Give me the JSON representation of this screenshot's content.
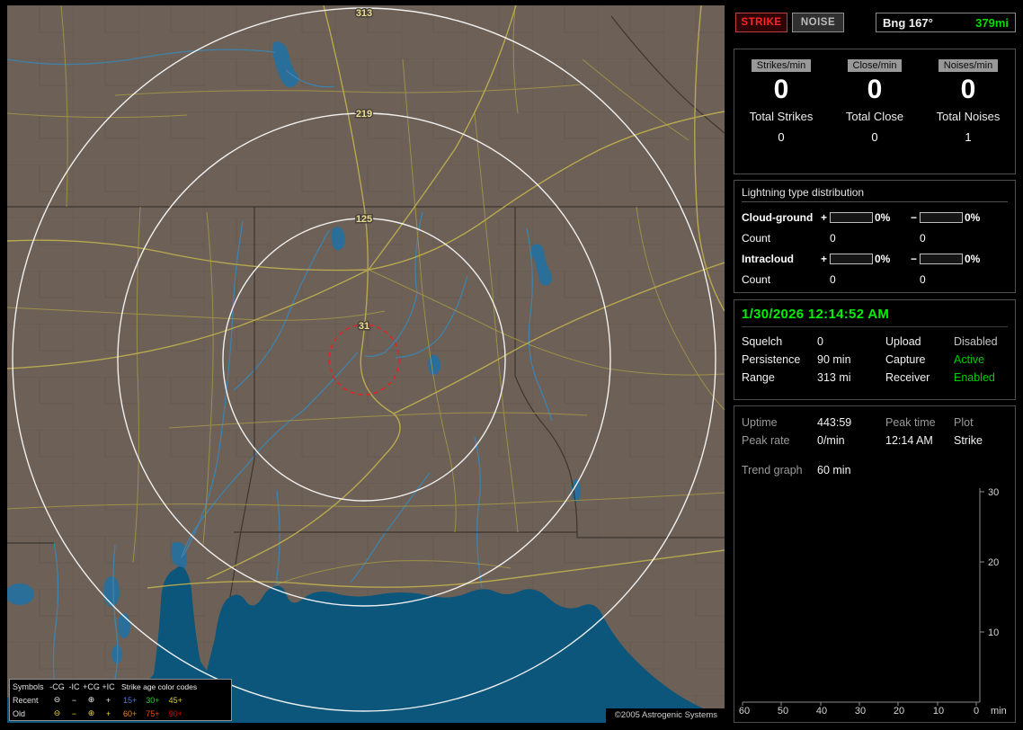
{
  "app": {
    "copyright": "©2005 Astrogenic Systems"
  },
  "map": {
    "range_rings": [
      {
        "label": "313"
      },
      {
        "label": "219"
      },
      {
        "label": "125"
      },
      {
        "label": "31"
      }
    ],
    "legend": {
      "symbols_header": "Symbols",
      "type_headers": [
        "-CG",
        "-IC",
        "+CG",
        "+IC"
      ],
      "age_header": "Strike age color codes",
      "rows": [
        {
          "label": "Recent",
          "symbols": [
            "⊖",
            "−",
            "⊕",
            "+"
          ],
          "ages": [
            "15+",
            "30+",
            "45+"
          ]
        },
        {
          "label": "Old",
          "symbols": [
            "⊖",
            "−",
            "⊕",
            "+"
          ],
          "ages": [
            "60+",
            "75+",
            "90+"
          ]
        }
      ]
    }
  },
  "topbar": {
    "strike": "STRIKE",
    "noise": "NOISE",
    "bearing": "Bng 167°",
    "distance": "379mi"
  },
  "stats": {
    "columns": [
      {
        "header": "Strikes/min",
        "rate": "0",
        "total_label": "Total Strikes",
        "total_value": "0"
      },
      {
        "header": "Close/min",
        "rate": "0",
        "total_label": "Total Close",
        "total_value": "0"
      },
      {
        "header": "Noises/min",
        "rate": "0",
        "total_label": "Total Noises",
        "total_value": "1"
      }
    ]
  },
  "distribution": {
    "title": "Lightning type distribution",
    "plus": "+",
    "minus": "−",
    "rows": [
      {
        "label": "Cloud-ground",
        "plus_pct": "0%",
        "minus_pct": "0%",
        "count_label": "Count",
        "plus_count": "0",
        "minus_count": "0"
      },
      {
        "label": "Intracloud",
        "plus_pct": "0%",
        "minus_pct": "0%",
        "count_label": "Count",
        "plus_count": "0",
        "minus_count": "0"
      }
    ]
  },
  "clock": {
    "timestamp": "1/30/2026 12:14:52 AM",
    "rows": [
      {
        "label1": "Squelch",
        "value1": "0",
        "label2": "Upload",
        "value2": "Disabled"
      },
      {
        "label1": "Persistence",
        "value1": "90 min",
        "label2": "Capture",
        "value2": "Active"
      },
      {
        "label1": "Range",
        "value1": "313 mi",
        "label2": "Receiver",
        "value2": "Enabled"
      }
    ]
  },
  "info": {
    "uptime_label": "Uptime",
    "uptime_value": "443:59",
    "peaktime_label": "Peak time",
    "peaktime_value": "12:14 AM",
    "plot_label": "Plot",
    "plot_value": "Strike",
    "peakrate_label": "Peak rate",
    "peakrate_value": "0/min",
    "trend_label": "Trend graph",
    "trend_value": "60 min"
  },
  "trend_graph": {
    "type": "line",
    "y_ticks": [
      "30",
      "20",
      "10"
    ],
    "x_ticks": [
      "60",
      "50",
      "40",
      "30",
      "20",
      "10",
      "0"
    ],
    "x_unit": "min",
    "ylim": [
      0,
      30
    ],
    "x_minutes_ago": [
      60,
      0
    ],
    "series": []
  },
  "palette": {
    "accent_green": "#00ef00",
    "strike_red": "#ff2424",
    "land": "#6d6057",
    "water": "#0d567b",
    "ring_white": "#f8f8f8",
    "close_ring_red": "#e62222",
    "age_colors": [
      "#4878f8",
      "#38c838",
      "#d8d030",
      "#e88820",
      "#f04818",
      "#d80000"
    ]
  }
}
